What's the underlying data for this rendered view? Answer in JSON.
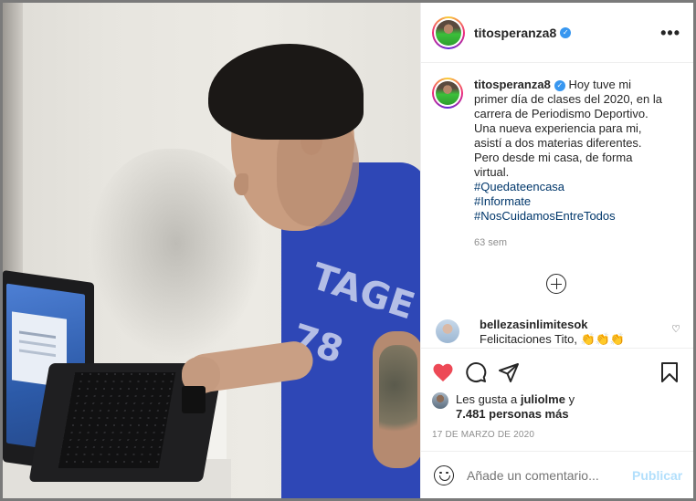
{
  "post": {
    "username": "titosperanza8",
    "more_label": "•••",
    "caption": "Hoy tuve mi primer día de clases del 2020, en la carrera de Periodismo Deportivo. Una nueva experiencia para mi, asistí a dos materias diferentes. Pero desde mi casa, de forma virtual.",
    "hashtags": [
      "#Quedateencasa",
      "#Informate",
      "#NosCuidamosEntreTodos"
    ],
    "time_ago": "63 sem",
    "photo_shirt_text": "TAGE 78"
  },
  "comments": [
    {
      "username": "bellezasinlimitesok",
      "text": "Felicitaciones Tito, 👏👏👏"
    }
  ],
  "actions": {
    "likes_prefix": "Les gusta a",
    "liked_by": "juliolme",
    "likes_connector": "y",
    "likes_count": "7.481 personas más",
    "date": "17 DE MARZO DE 2020"
  },
  "add_comment": {
    "placeholder": "Añade un comentario...",
    "post_label": "Publicar"
  },
  "colors": {
    "like_red": "#ed4956",
    "link_blue": "#00376b",
    "verified_blue": "#3897f0",
    "publish_disabled": "#b2dffc"
  },
  "icons": [
    "verified-badge-icon",
    "more-options-icon",
    "add-circle-icon",
    "heart-outline-icon",
    "heart-filled-icon",
    "comment-icon",
    "share-icon",
    "bookmark-icon",
    "emoji-icon"
  ]
}
